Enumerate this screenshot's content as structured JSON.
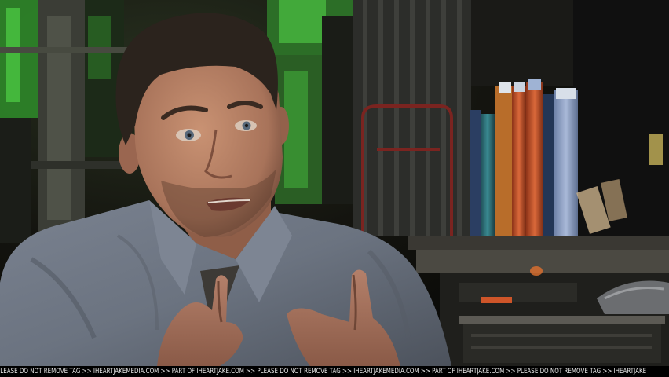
{
  "watermark": {
    "text": "PLEASE DO NOT REMOVE TAG >> IHEARTJAKEMEDIA.COM >> PART OF IHEARTJAKE.COM >> PLEASE DO NOT REMOVE TAG >> IHEARTJAKEMEDIA.COM >> PART OF IHEARTJAKE.COM >> PLEASE DO NOT REMOVE TAG >> IHEARTJAKE"
  },
  "scene": {
    "subject": "man in grey button-down shirt speaking and gesturing with both hands",
    "setting": "dark industrial set with green-lit machinery, shelving and rolls of colored material"
  },
  "colors": {
    "background": "#14140f",
    "shirt": "#6e7683",
    "skin": "#b98466",
    "hair": "#2b231d",
    "tie": "#3d3a36",
    "green_glow": "#3fbe3a",
    "orange_roll": "#c8542a",
    "blue_roll": "#8fa1c4"
  }
}
